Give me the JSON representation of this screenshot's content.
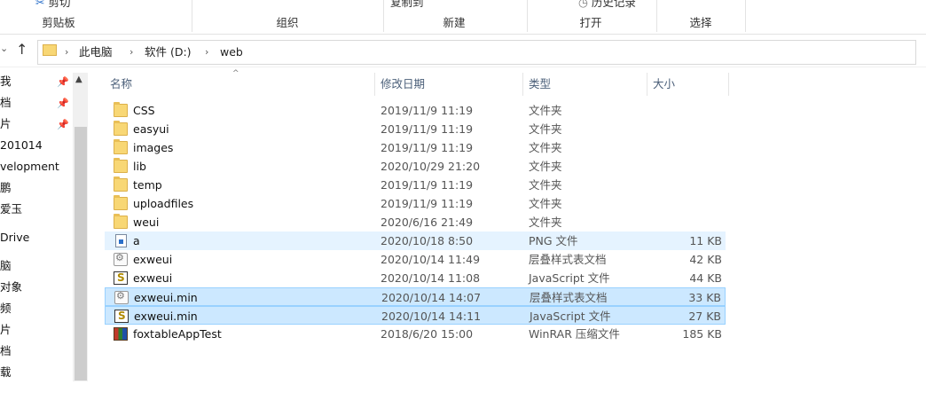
{
  "ribbon": {
    "clipboard_top": "剪切",
    "organize_top": "复制到",
    "history_top": "历史记录",
    "groups": [
      "剪贴板",
      "组织",
      "新建",
      "打开",
      "选择"
    ]
  },
  "address": {
    "crumbs": [
      "此电脑",
      "软件 (D:)",
      "web"
    ]
  },
  "nav": {
    "items": [
      "我",
      "档",
      "片",
      "201014",
      "velopment",
      "鹏",
      "爱玉",
      "Drive",
      "脑",
      "对象",
      "频",
      "片",
      "档",
      "载"
    ]
  },
  "columns": {
    "name": "名称",
    "date": "修改日期",
    "type": "类型",
    "size": "大小"
  },
  "files": [
    {
      "name": "CSS",
      "date": "2019/11/9 11:19",
      "type": "文件夹",
      "size": "",
      "icon": "folder-icon"
    },
    {
      "name": "easyui",
      "date": "2019/11/9 11:19",
      "type": "文件夹",
      "size": "",
      "icon": "folder-icon"
    },
    {
      "name": "images",
      "date": "2019/11/9 11:19",
      "type": "文件夹",
      "size": "",
      "icon": "folder-icon"
    },
    {
      "name": "lib",
      "date": "2020/10/29 21:20",
      "type": "文件夹",
      "size": "",
      "icon": "folder-icon"
    },
    {
      "name": "temp",
      "date": "2019/11/9 11:19",
      "type": "文件夹",
      "size": "",
      "icon": "folder-icon"
    },
    {
      "name": "uploadfiles",
      "date": "2019/11/9 11:19",
      "type": "文件夹",
      "size": "",
      "icon": "folder-icon"
    },
    {
      "name": "weui",
      "date": "2020/6/16 21:49",
      "type": "文件夹",
      "size": "",
      "icon": "folder-icon"
    },
    {
      "name": "a",
      "date": "2020/10/18 8:50",
      "type": "PNG 文件",
      "size": "11 KB",
      "icon": "png-file-icon"
    },
    {
      "name": "exweui",
      "date": "2020/10/14 11:49",
      "type": "层叠样式表文档",
      "size": "42 KB",
      "icon": "css-file-icon"
    },
    {
      "name": "exweui",
      "date": "2020/10/14 11:08",
      "type": "JavaScript 文件",
      "size": "44 KB",
      "icon": "js-file-icon"
    },
    {
      "name": "exweui.min",
      "date": "2020/10/14 14:07",
      "type": "层叠样式表文档",
      "size": "33 KB",
      "icon": "css-file-icon"
    },
    {
      "name": "exweui.min",
      "date": "2020/10/14 14:11",
      "type": "JavaScript 文件",
      "size": "27 KB",
      "icon": "js-file-icon"
    },
    {
      "name": "foxtableAppTest",
      "date": "2018/6/20 15:00",
      "type": "WinRAR 压缩文件",
      "size": "185 KB",
      "icon": "rar-archive-icon"
    }
  ]
}
